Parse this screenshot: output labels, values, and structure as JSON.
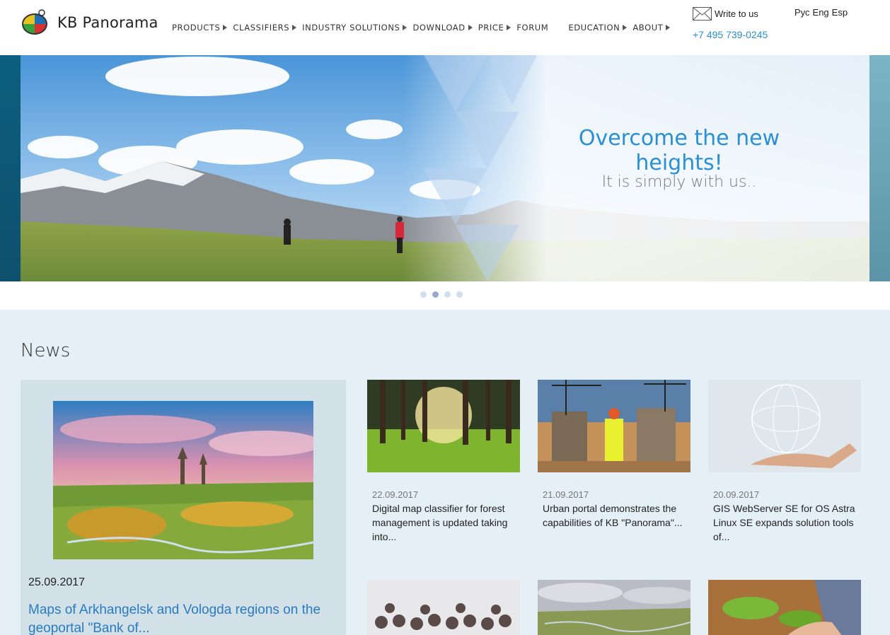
{
  "brand": {
    "name": "KB Panorama"
  },
  "nav": {
    "items": [
      {
        "label": "PRODUCTS",
        "has_submenu": true
      },
      {
        "label": "CLASSIFIERS",
        "has_submenu": true
      },
      {
        "label": "INDUSTRY SOLUTIONS",
        "has_submenu": true
      },
      {
        "label": "DOWNLOAD",
        "has_submenu": true
      },
      {
        "label": "PRICE",
        "has_submenu": true
      },
      {
        "label": "FORUM",
        "has_submenu": false
      },
      {
        "label": "EDUCATION",
        "has_submenu": true
      },
      {
        "label": "ABOUT",
        "has_submenu": true
      }
    ]
  },
  "contact": {
    "write_label": "Write to us",
    "phone": "+7 495 739-0245"
  },
  "languages": [
    "Рус",
    "Eng",
    "Esp"
  ],
  "banner": {
    "title": "Overcome the new heights!",
    "subtitle": "It is simply with us..",
    "slide_count": 4,
    "active_slide": 2
  },
  "news": {
    "heading": "News",
    "featured": {
      "date": "25.09.2017",
      "title": "Maps of Arkhangelsk and Vologda regions on the geoportal \"Bank of..."
    },
    "items": [
      {
        "date": "22.09.2017",
        "title": "Digital map classifier for forest management is updated taking into..."
      },
      {
        "date": "21.09.2017",
        "title": "Urban portal demonstrates the capabilities of KB \"Panorama\"..."
      },
      {
        "date": "20.09.2017",
        "title": "GIS WebServer SE for OS Astra Linux SE expands solution tools of..."
      }
    ]
  },
  "colors": {
    "accent": "#2b8fd4",
    "news_bg": "#e5eff6",
    "featured_bg": "#d2e0e8"
  }
}
